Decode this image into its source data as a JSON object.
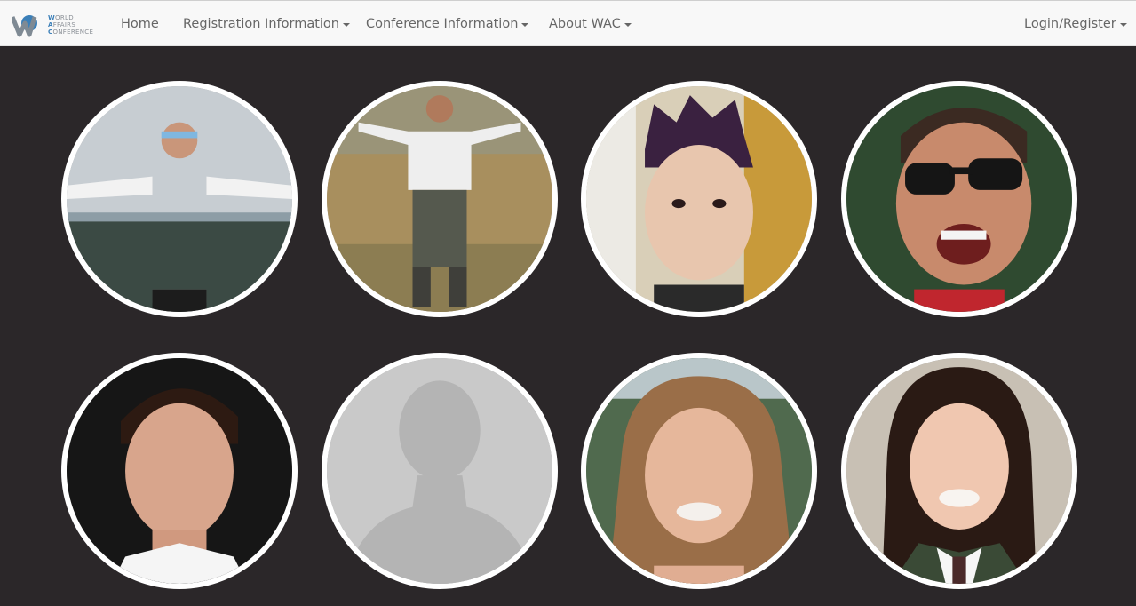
{
  "brand": {
    "lines": [
      "WORLD",
      "AFFAIRS",
      "CONFERENCE"
    ],
    "accent": "#3b7fb8"
  },
  "nav": {
    "home": "Home",
    "registration": "Registration Information",
    "conference": "Conference Information",
    "about": "About WAC",
    "login": "Login/Register"
  },
  "profiles": [
    {
      "icon": "profile-photo-icon"
    },
    {
      "icon": "profile-photo-icon"
    },
    {
      "icon": "profile-photo-icon"
    },
    {
      "icon": "profile-photo-icon"
    },
    {
      "icon": "profile-photo-icon"
    },
    {
      "icon": "default-avatar-icon"
    },
    {
      "icon": "profile-photo-icon"
    },
    {
      "icon": "profile-photo-icon"
    }
  ],
  "colors": {
    "background": "#2b2729",
    "navbar": "#f8f8f8",
    "border": "#ffffff"
  }
}
